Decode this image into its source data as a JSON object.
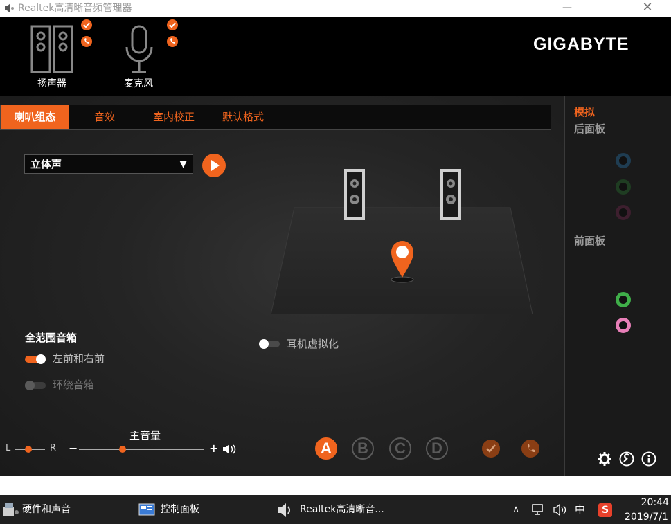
{
  "window": {
    "title": "Realtek高清晰音频管理器",
    "min_icon": "minimize-icon",
    "max_icon": "maximize-icon",
    "close_icon": "close-icon"
  },
  "devices": [
    {
      "label": "扬声器",
      "icon": "speaker-icon",
      "active": true
    },
    {
      "label": "麦克风",
      "icon": "microphone-icon",
      "active": false
    }
  ],
  "brand": {
    "logo": "GIGABYTE"
  },
  "tabs": [
    {
      "label": "喇叭组态",
      "active": true
    },
    {
      "label": "音效",
      "active": false
    },
    {
      "label": "室内校正",
      "active": false
    },
    {
      "label": "默认格式",
      "active": false
    }
  ],
  "config": {
    "selected": "立体声",
    "headphone_virtualization": "耳机虚拟化",
    "full_range_title": "全范围音箱",
    "front_lr": "左前和右前",
    "surround": "环绕音箱"
  },
  "volume": {
    "title": "主音量",
    "balance_left": "L",
    "balance_right": "R",
    "minus": "−",
    "plus": "+",
    "balance_level": 0.45,
    "master_level": 0.35
  },
  "presets": [
    "A",
    "B",
    "C",
    "D"
  ],
  "sidebar": {
    "analog": "模拟",
    "rear_panel": "后面板",
    "front_panel": "前面板"
  },
  "taskbar": {
    "items": [
      "硬件和声音",
      "控制面板",
      "Realtek高清晰音..."
    ],
    "time": "20:44",
    "date": "2019/7/1",
    "ime": "中"
  },
  "colors": {
    "accent": "#f0641e",
    "jack_green": "#3fae49",
    "jack_pink": "#e87fb8"
  }
}
